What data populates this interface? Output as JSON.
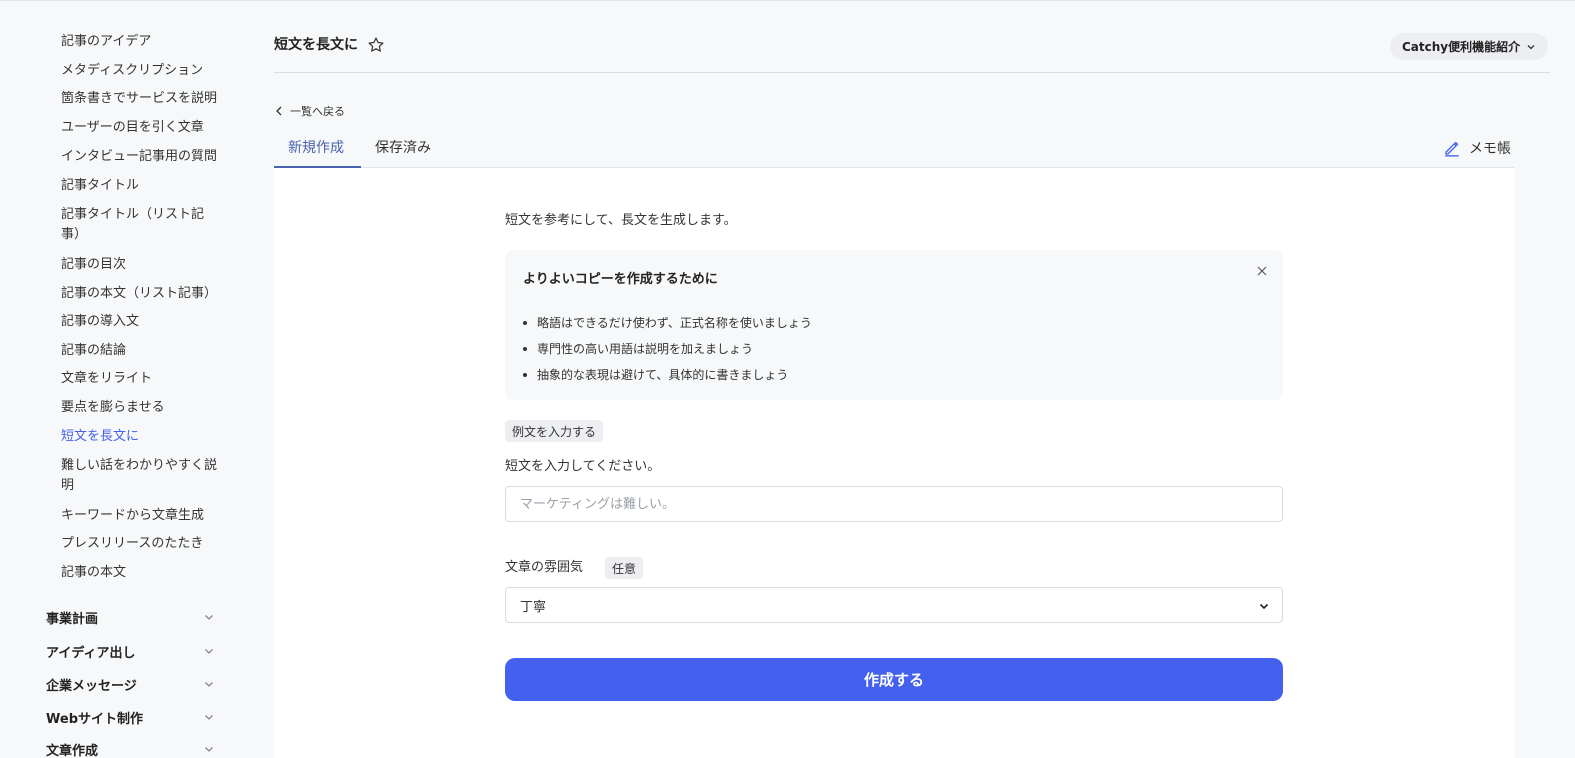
{
  "sidebar": {
    "sub_items": [
      {
        "label": "記事のアイデア",
        "active": false
      },
      {
        "label": "メタディスクリプション",
        "active": false
      },
      {
        "label": "箇条書きでサービスを説明",
        "active": false
      },
      {
        "label": "ユーザーの目を引く文章",
        "active": false
      },
      {
        "label": "インタビュー記事用の質問",
        "active": false
      },
      {
        "label": "記事タイトル",
        "active": false
      },
      {
        "label": "記事タイトル（リスト記事）",
        "active": false
      },
      {
        "label": "記事の目次",
        "active": false
      },
      {
        "label": "記事の本文（リスト記事）",
        "active": false
      },
      {
        "label": "記事の導入文",
        "active": false
      },
      {
        "label": "記事の結論",
        "active": false
      },
      {
        "label": "文章をリライト",
        "active": false
      },
      {
        "label": "要点を膨らませる",
        "active": false
      },
      {
        "label": "短文を長文に",
        "active": true
      },
      {
        "label": "難しい話をわかりやすく説明",
        "active": false
      },
      {
        "label": "キーワードから文章生成",
        "active": false
      },
      {
        "label": "プレスリリースのたたき",
        "active": false
      },
      {
        "label": "記事の本文",
        "active": false
      }
    ],
    "categories": [
      {
        "label": "事業計画",
        "icon": "chevron-down-icon"
      },
      {
        "label": "アイディア出し",
        "icon": "chevron-down-icon"
      },
      {
        "label": "企業メッセージ",
        "icon": "chevron-down-icon"
      },
      {
        "label": "Webサイト制作",
        "icon": "chevron-down-icon"
      },
      {
        "label": "文章作成",
        "icon": "chevron-down-icon"
      }
    ]
  },
  "header": {
    "title": "短文を長文に",
    "star_icon": "star-outline-icon",
    "feature_intro_label": "Catchy便利機能紹介"
  },
  "nav": {
    "back_label": "一覧へ戻る",
    "tabs": [
      {
        "label": "新規作成",
        "active": true
      },
      {
        "label": "保存済み",
        "active": false
      }
    ],
    "memo_label": "メモ帳",
    "memo_icon": "pencil-icon"
  },
  "form": {
    "description": "短文を参考にして、長文を生成します。",
    "tips": {
      "title": "よりよいコピーを作成するために",
      "items": [
        "略語はできるだけ使わず、正式名称を使いましょう",
        "専門性の高い用語は説明を加えましょう",
        "抽象的な表現は避けて、具体的に書きましょう"
      ]
    },
    "example_button": "例文を入力する",
    "short_text_label": "短文を入力してください。",
    "short_text_placeholder": "マーケティングは難しい。",
    "short_text_value": "",
    "tone_label": "文章の雰囲気",
    "optional_badge": "任意",
    "tone_selected": "丁寧",
    "create_button": "作成する"
  },
  "colors": {
    "accent": "#4361ee",
    "tab_active": "#4a62b0",
    "background": "#f7f8fa",
    "panel": "#ffffff"
  }
}
